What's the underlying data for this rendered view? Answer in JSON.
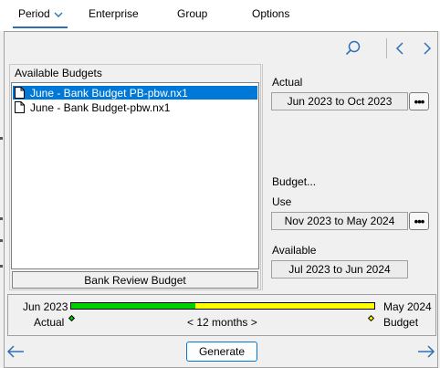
{
  "menu": {
    "items": [
      {
        "label": "Period",
        "name": "menu-period"
      },
      {
        "label": "Enterprise",
        "name": "menu-enterprise"
      },
      {
        "label": "Group",
        "name": "menu-group"
      },
      {
        "label": "Options",
        "name": "menu-options"
      }
    ]
  },
  "toolbar": {
    "search_icon": "search-icon",
    "prev_icon": "chevron-left-icon",
    "next_icon": "chevron-right-icon"
  },
  "budgets": {
    "caption": "Available Budgets",
    "items": [
      {
        "label": "June - Bank Budget PB-pbw.nx1",
        "selected": true
      },
      {
        "label": "June - Bank Budget-pbw.nx1",
        "selected": false
      }
    ],
    "status": "Bank Review Budget"
  },
  "periods": {
    "actual_label": "Actual",
    "actual_range": "Jun 2023 to Oct 2023",
    "budget_label": "Budget...",
    "use_label": "Use",
    "use_range": "Nov 2023 to May 2024",
    "available_label": "Available",
    "available_range": "Jul 2023 to Jun 2024",
    "ellipsis": "•••"
  },
  "timeline": {
    "start": "Jun 2023",
    "end": "May 2024",
    "start_caption": "Actual",
    "end_caption": "Budget",
    "span": "< 12 months >",
    "actual_fraction": 0.41,
    "actual_color": "#00d000",
    "budget_color": "#ffff00"
  },
  "actions": {
    "generate": "Generate",
    "back_icon": "arrow-left-icon",
    "forward_icon": "arrow-right-icon"
  },
  "colors": {
    "accent": "#0078d7",
    "selection": "#0078d7"
  }
}
